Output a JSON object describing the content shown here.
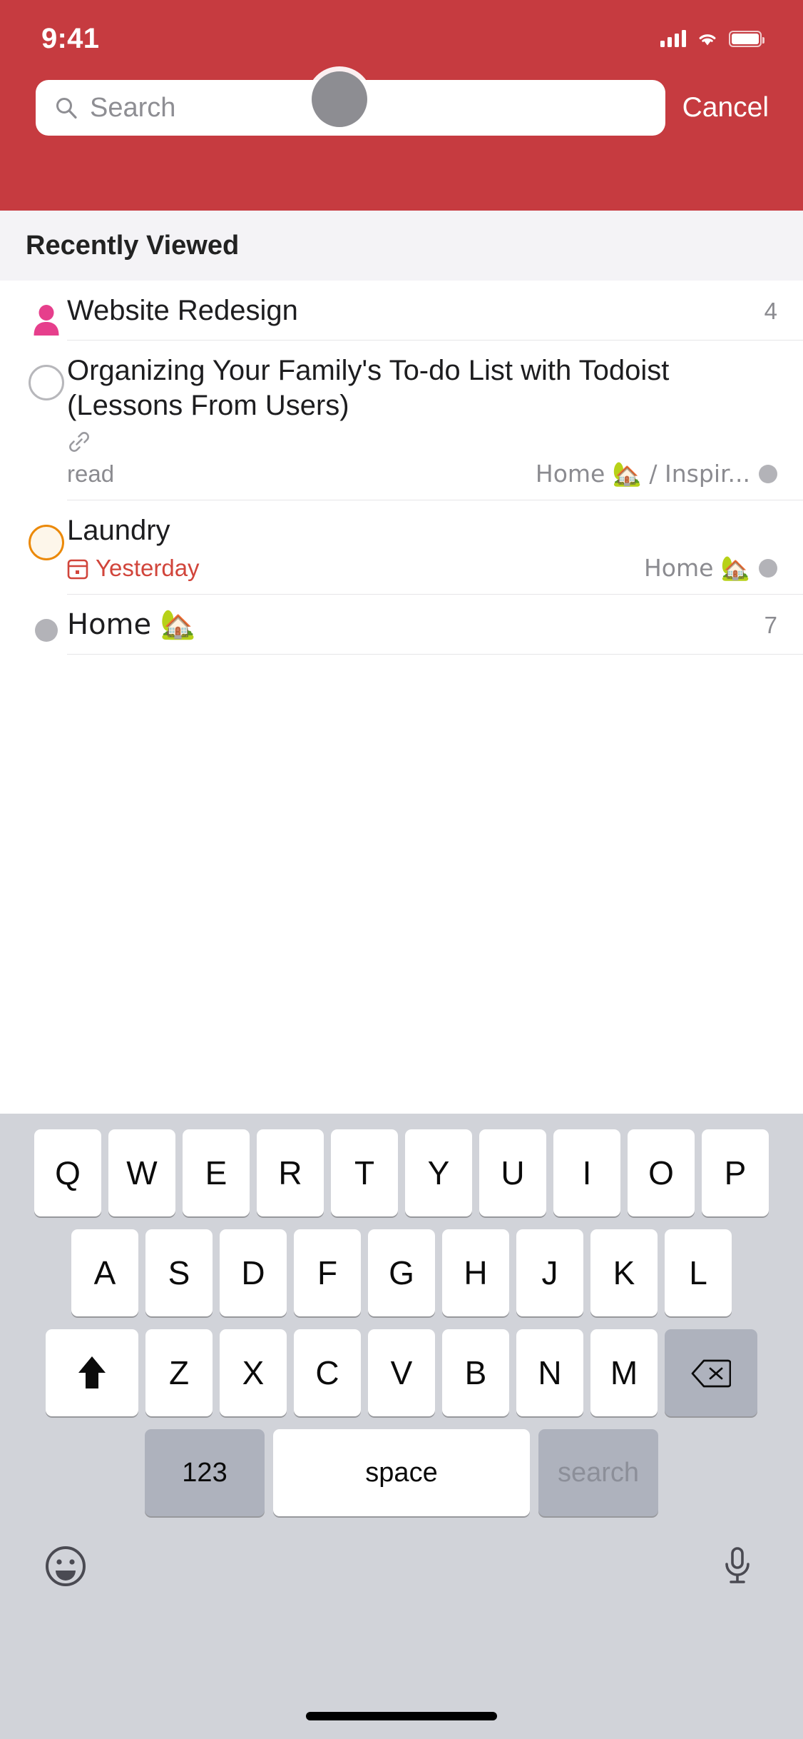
{
  "status_bar": {
    "time": "9:41",
    "cellular_icon": "signal-bars-icon",
    "wifi_icon": "wifi-icon",
    "battery_icon": "battery-icon"
  },
  "header": {
    "background_color": "#c63b40",
    "search": {
      "placeholder": "Search",
      "value": "",
      "icon": "search-icon"
    },
    "cancel_label": "Cancel"
  },
  "touch_indicator": {
    "name": "touch-cursor",
    "color": "#8d8d92"
  },
  "section": {
    "title": "Recently Viewed"
  },
  "list": {
    "items": [
      {
        "type": "label",
        "icon": "person-icon",
        "icon_color": "#e63f8c",
        "title": "Website Redesign",
        "count": "4"
      },
      {
        "type": "task",
        "icon": "checkbox-circle-icon",
        "title": "Organizing Your Family's To-do List with Todoist (Lessons From Users)",
        "link_icon": "link-icon",
        "meta_left": "read",
        "meta_right": "Home 🏡 / Inspir...",
        "project_dot_color": "#b3b3b8"
      },
      {
        "type": "task",
        "icon": "checkbox-circle-icon",
        "icon_color": "#eb8909",
        "title": "Laundry",
        "due_icon": "calendar-icon",
        "due_date": "Yesterday",
        "due_color": "#d1453b",
        "meta_right": "Home 🏡",
        "project_dot_color": "#b3b3b8"
      },
      {
        "type": "project",
        "icon": "project-dot-icon",
        "icon_color": "#b3b3b8",
        "title": "Home 🏡",
        "count": "7"
      }
    ]
  },
  "keyboard": {
    "row1": [
      "Q",
      "W",
      "E",
      "R",
      "T",
      "Y",
      "U",
      "I",
      "O",
      "P"
    ],
    "row2": [
      "A",
      "S",
      "D",
      "F",
      "G",
      "H",
      "J",
      "K",
      "L"
    ],
    "row3": [
      "Z",
      "X",
      "C",
      "V",
      "B",
      "N",
      "M"
    ],
    "shift_icon": "shift-up-arrow-icon",
    "backspace_icon": "backspace-icon",
    "numbers_label": "123",
    "space_label": "space",
    "return_label": "search",
    "emoji_icon": "emoji-smiley-icon",
    "mic_icon": "microphone-icon"
  }
}
